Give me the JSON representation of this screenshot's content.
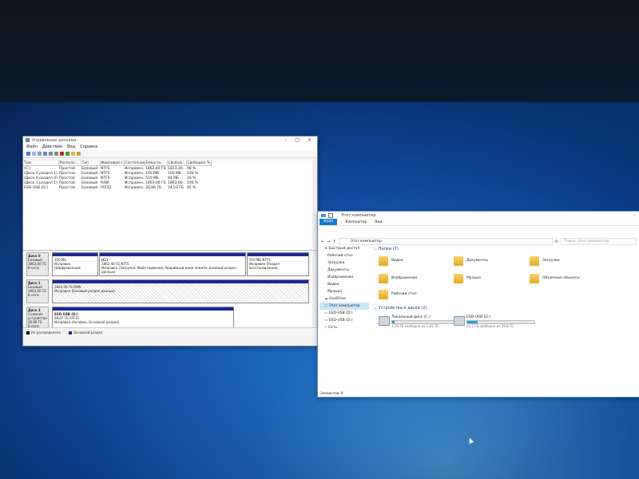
{
  "disk_management": {
    "title": "Управление дисками",
    "menu": [
      "Файл",
      "Действие",
      "Вид",
      "Справка"
    ],
    "columns": [
      "Том",
      "Располо...",
      "Тип",
      "Файловая с...",
      "Состояние",
      "Емкость",
      "Свобод...",
      "Свободно %"
    ],
    "rows": [
      [
        "(C:)",
        "Простой",
        "Базовый",
        "NTFS",
        "Исправен...",
        "1862,40 ГБ",
        "1823,36...",
        "98 %"
      ],
      [
        "(Диск 0 раздел 1)",
        "Простой",
        "Базовый",
        "NTFS",
        "Исправен...",
        "100 МБ",
        "100 МБ",
        "100 %"
      ],
      [
        "(Диск 0 раздел 4)",
        "Простой",
        "Базовый",
        "NTFS",
        "Исправен...",
        "510 МБ",
        "84 МБ",
        "16 %"
      ],
      [
        "(Диск 1 раздел 1)",
        "Простой",
        "Базовый",
        "RAW",
        "Исправен...",
        "1863,00 ГБ",
        "1863,00...",
        "100 %"
      ],
      [
        "ESD-USB (D:)",
        "Простой",
        "Базовый",
        "FAT32",
        "Исправен...",
        "28,86 ГБ",
        "24,53 ГБ",
        "85 %"
      ]
    ],
    "disks": [
      {
        "label_lines": [
          "Диск 0",
          "Базовый",
          "1863,00 ГБ",
          "В сети"
        ],
        "partitions": [
          {
            "lines": [
              "100 МБ",
              "Исправен (Шифрованный"
            ]
          },
          {
            "lines": [
              "(C:)",
              "1862,40 ГБ NTFS",
              "Исправен (Загрузка, Файл подкачки, Аварийный дамп памяти, Базовый раздел данных)"
            ]
          },
          {
            "lines": [
              "510 МБ NTFS",
              "Исправен (Раздел восстановления)"
            ]
          }
        ]
      },
      {
        "label_lines": [
          "Диск 1",
          "Базовый",
          "1863,00 ГБ",
          "В сети"
        ],
        "partitions": [
          {
            "lines": [
              "1863,00 ГБ RAW",
              "Исправен (Базовый раздел данных)"
            ]
          }
        ]
      },
      {
        "label_lines": [
          "Диск 2",
          "Съемное устройство",
          "28,86 ГБ",
          "В сети"
        ],
        "partitions": [
          {
            "lines": [
              "ESD-USB (D:)",
              "28,87 ГБ FAT32",
              "Исправен (Активен, Основной раздел)"
            ]
          }
        ]
      }
    ],
    "legend": [
      "Не распределена",
      "Основной раздел"
    ],
    "colors": {
      "legend_unallocated": "#111111",
      "legend_primary": "#1a2a9a"
    }
  },
  "explorer": {
    "title": "Этот компьютер",
    "ribbon_tabs": [
      "Файл",
      "Компьютер",
      "Вид"
    ],
    "address": "Этот компьютер",
    "search_placeholder": "Поиск: Этот компьютер",
    "nav": [
      {
        "label": "Быстрый доступ"
      },
      {
        "label": "Рабочий стол"
      },
      {
        "label": "Загрузки"
      },
      {
        "label": "Документы"
      },
      {
        "label": "Изображения"
      },
      {
        "label": "Видео"
      },
      {
        "label": "Музыка"
      },
      {
        "label": "OneDrive"
      },
      {
        "label": "Этот компьютер",
        "selected": true
      },
      {
        "label": "ESD-USB (D:)"
      },
      {
        "label": "ESD-USB (D:)"
      },
      {
        "label": "Сеть"
      }
    ],
    "folders_header": "Папки (7)",
    "folders": [
      "Видео",
      "Документы",
      "Загрузки",
      "Изображения",
      "Музыка",
      "Объемные объекты",
      "Рабочий стол"
    ],
    "drives_header": "Устройства и диски (2)",
    "drives": [
      {
        "name": "Локальный диск (C:)",
        "free": "1,78 ТБ свободно из 1,81 ТБ",
        "used_fraction": 0.02
      },
      {
        "name": "ESD-USB (D:)",
        "free": "24,5 ГБ свободно из 28,8 ГБ",
        "used_fraction": 0.15
      }
    ],
    "status": "Элементов: 9"
  }
}
